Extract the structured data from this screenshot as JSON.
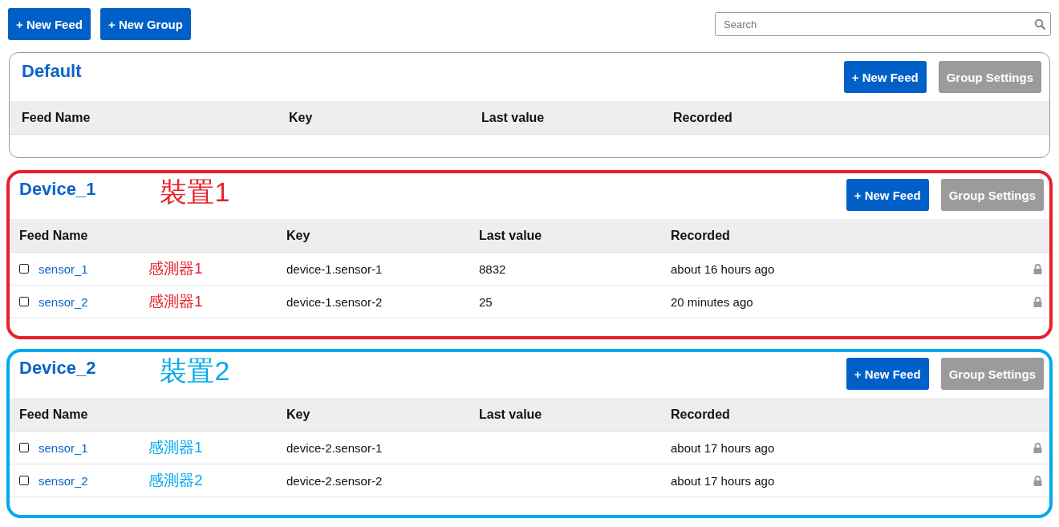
{
  "toolbar": {
    "buttons": [
      "+ New Feed",
      "+ New Group"
    ],
    "search": {
      "placeholder": "Search"
    }
  },
  "groups": [
    {
      "name": "Default",
      "new_feed": "+ New Feed",
      "settings": "Group Settings",
      "columns": [
        "Feed Name",
        "Key",
        "Last value",
        "Recorded"
      ]
    },
    {
      "name": "Device_1",
      "color": "#e8202a",
      "annotation": "裝置1",
      "new_feed": "+ New Feed",
      "settings": "Group Settings",
      "columns": [
        "Feed Name",
        "Key",
        "Last value",
        "Recorded"
      ],
      "feeds": [
        {
          "name": "sensor_1",
          "note": "感測器1",
          "key": "device-1.sensor-1",
          "last_value": "8832",
          "recorded": "about 16 hours ago",
          "checked": false
        },
        {
          "name": "sensor_2",
          "note": "感測器1",
          "key": "device-1.sensor-2",
          "last_value": "25",
          "recorded": "20 minutes ago",
          "checked": false
        }
      ]
    },
    {
      "name": "Device_2",
      "color": "#00aaee",
      "annotation": "裝置2",
      "new_feed": "+ New Feed",
      "settings": "Group Settings",
      "columns": [
        "Feed Name",
        "Key",
        "Last value",
        "Recorded"
      ],
      "feeds": [
        {
          "name": "sensor_1",
          "note": "感測器1",
          "key": "device-2.sensor-1",
          "recorded": "about 17 hours ago",
          "checked": false
        },
        {
          "name": "sensor_2",
          "note": "感測器2",
          "key": "device-2.sensor-2",
          "recorded": "about 17 hours ago",
          "checked": false
        }
      ]
    }
  ]
}
